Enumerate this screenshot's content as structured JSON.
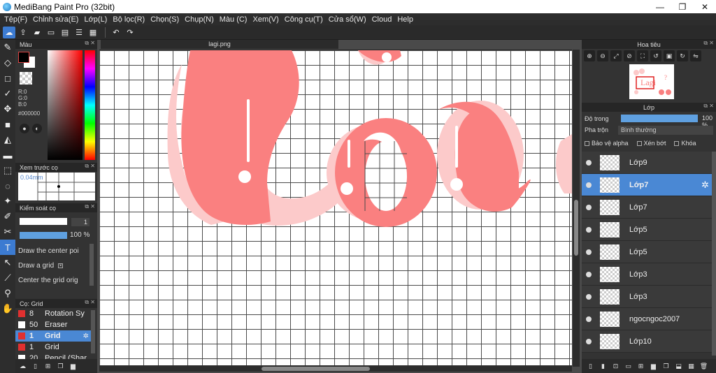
{
  "window": {
    "title": "MediBang Paint Pro (32bit)",
    "minimize": "—",
    "maximize": "❐",
    "close": "✕"
  },
  "menu": [
    "Tệp(F)",
    "Chỉnh sửa(E)",
    "Lớp(L)",
    "Bộ lọc(R)",
    "Chọn(S)",
    "Chụp(N)",
    "Màu (C)",
    "Xem(V)",
    "Công cụ(T)",
    "Cửa sổ(W)",
    "Cloud",
    "Help"
  ],
  "colors": {
    "accent": "#4a88d4",
    "pink": "#fa8080",
    "pink_light": "#fccaca"
  },
  "color_panel": {
    "title": "Màu",
    "r": "R:0",
    "g": "G:0",
    "b": "B:0",
    "hex": "#000000"
  },
  "brush_preview": {
    "title": "Xem trước cọ",
    "size": "0.04mm"
  },
  "brush_control": {
    "title": "Kiểm soát cọ",
    "size_value": "1",
    "opacity_value": "100 %",
    "options": [
      "Draw the center poi",
      "Draw a grid",
      "Center the grid orig"
    ]
  },
  "brush_list": {
    "title": "Cọ: Grid",
    "items": [
      {
        "size": "8",
        "name": "Rotation Sy",
        "color": "#e03030"
      },
      {
        "size": "50",
        "name": "Eraser",
        "color": "#ffffff"
      },
      {
        "size": "1",
        "name": "Grid",
        "color": "#e03030",
        "active": true
      },
      {
        "size": "1",
        "name": "Grid",
        "color": "#e03030"
      },
      {
        "size": "20",
        "name": "Pencil (Shar",
        "color": "#ffffff"
      }
    ]
  },
  "document": {
    "tab": "lagi.png"
  },
  "navigator": {
    "title": "Hoa tiêu"
  },
  "layer_panel": {
    "title": "Lớp",
    "opacity_label": "Độ trong",
    "opacity_value": "100 %",
    "blend_label": "Pha trộn",
    "blend_value": "Bình thường",
    "protect_alpha": "Bảo vệ alpha",
    "clip": "Xén bớt",
    "lock": "Khóa",
    "layers": [
      {
        "name": "Lớp9"
      },
      {
        "name": "Lớp7",
        "active": true
      },
      {
        "name": "Lớp7"
      },
      {
        "name": "Lớp5"
      },
      {
        "name": "Lớp5"
      },
      {
        "name": "Lớp3"
      },
      {
        "name": "Lớp3"
      },
      {
        "name": "ngocngoc2007"
      },
      {
        "name": "Lớp10"
      }
    ]
  }
}
